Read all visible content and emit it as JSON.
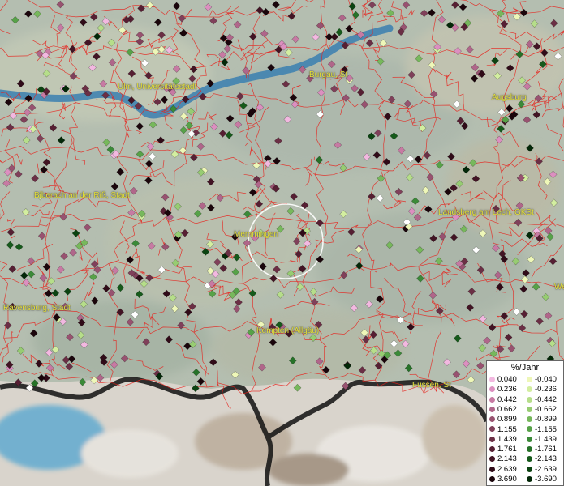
{
  "cities": [
    {
      "name": "Ulm, Universitätsstadt"
    },
    {
      "name": "Burgau, St"
    },
    {
      "name": "Augsburg"
    },
    {
      "name": "Biberach an der Riß, Stadt"
    },
    {
      "name": "Memmingen"
    },
    {
      "name": "Landsberg am Lech, GKSt"
    },
    {
      "name": "Ravensburg, Stadt"
    },
    {
      "name": "Kempten (Allgäu)"
    },
    {
      "name": "Füssen, St"
    },
    {
      "name": "We"
    }
  ],
  "legend": {
    "title": "%/Jahr",
    "positive": [
      {
        "label": "0.040",
        "color": "#f2b8e0"
      },
      {
        "label": "0.236",
        "color": "#dc8fc0"
      },
      {
        "label": "0.442",
        "color": "#c77aa3"
      },
      {
        "label": "0.662",
        "color": "#b0668a"
      },
      {
        "label": "0.899",
        "color": "#985270"
      },
      {
        "label": "1.155",
        "color": "#80405a"
      },
      {
        "label": "1.439",
        "color": "#6b2f45"
      },
      {
        "label": "1.761",
        "color": "#561f33"
      },
      {
        "label": "2.143",
        "color": "#421424"
      },
      {
        "label": "2.639",
        "color": "#300b18"
      },
      {
        "label": "3.690",
        "color": "#1a050b"
      }
    ],
    "negative": [
      {
        "label": "-0.040",
        "color": "#eef7b8"
      },
      {
        "label": "-0.236",
        "color": "#d3eea0"
      },
      {
        "label": "-0.442",
        "color": "#b6de8a"
      },
      {
        "label": "-0.662",
        "color": "#97cc72"
      },
      {
        "label": "-0.899",
        "color": "#77b85c"
      },
      {
        "label": "-1.155",
        "color": "#57a248"
      },
      {
        "label": "-1.439",
        "color": "#3b8a38"
      },
      {
        "label": "-1.761",
        "color": "#267228"
      },
      {
        "label": "-2.143",
        "color": "#165a1b"
      },
      {
        "label": "-2.639",
        "color": "#0b4311"
      },
      {
        "label": "-3.690",
        "color": "#032808"
      }
    ]
  },
  "colors": {
    "terrain": "#b3bfb0",
    "river": "#3a7fb0",
    "boundary": "#e8201a",
    "city_text": "#e6e23a",
    "zero_point": "#ffffff"
  }
}
